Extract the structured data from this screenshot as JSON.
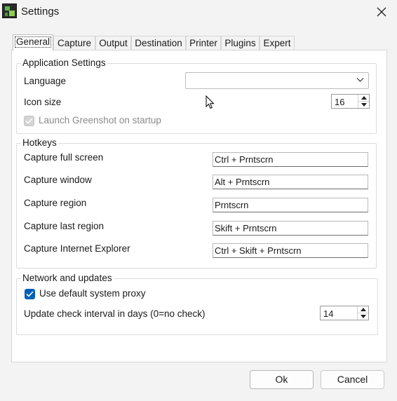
{
  "window": {
    "title": "Settings"
  },
  "tabs": [
    {
      "label": "General",
      "active": true
    },
    {
      "label": "Capture"
    },
    {
      "label": "Output"
    },
    {
      "label": "Destination"
    },
    {
      "label": "Printer"
    },
    {
      "label": "Plugins"
    },
    {
      "label": "Expert"
    }
  ],
  "app_settings": {
    "title": "Application Settings",
    "language_label": "Language",
    "language_value": "",
    "icon_size_label": "Icon size",
    "icon_size_value": "16",
    "launch_label": "Launch Greenshot on startup",
    "launch_checked": true,
    "launch_disabled": true
  },
  "hotkeys": {
    "title": "Hotkeys",
    "rows": [
      {
        "label": "Capture full screen",
        "value": "Ctrl + Prntscrn"
      },
      {
        "label": "Capture window",
        "value": "Alt + Prntscrn"
      },
      {
        "label": "Capture region",
        "value": "Prntscrn"
      },
      {
        "label": "Capture last region",
        "value": "Skift + Prntscrn"
      },
      {
        "label": "Capture Internet Explorer",
        "value": "Ctrl + Skift + Prntscrn"
      }
    ]
  },
  "network": {
    "title": "Network and updates",
    "proxy_label": "Use default system proxy",
    "proxy_checked": true,
    "interval_label": "Update check interval in days (0=no check)",
    "interval_value": "14"
  },
  "buttons": {
    "ok": "Ok",
    "cancel": "Cancel"
  },
  "icons": {
    "app": "greenshot-app-icon",
    "close": "close-icon",
    "dropdown": "chevron-down-icon",
    "spin_up": "spin-up-icon",
    "spin_down": "spin-down-icon",
    "check": "checkmark-icon",
    "cursor": "mouse-pointer-icon"
  },
  "colors": {
    "accent": "#005fb8",
    "panel": "#ffffff",
    "window": "#f3f3f3"
  }
}
